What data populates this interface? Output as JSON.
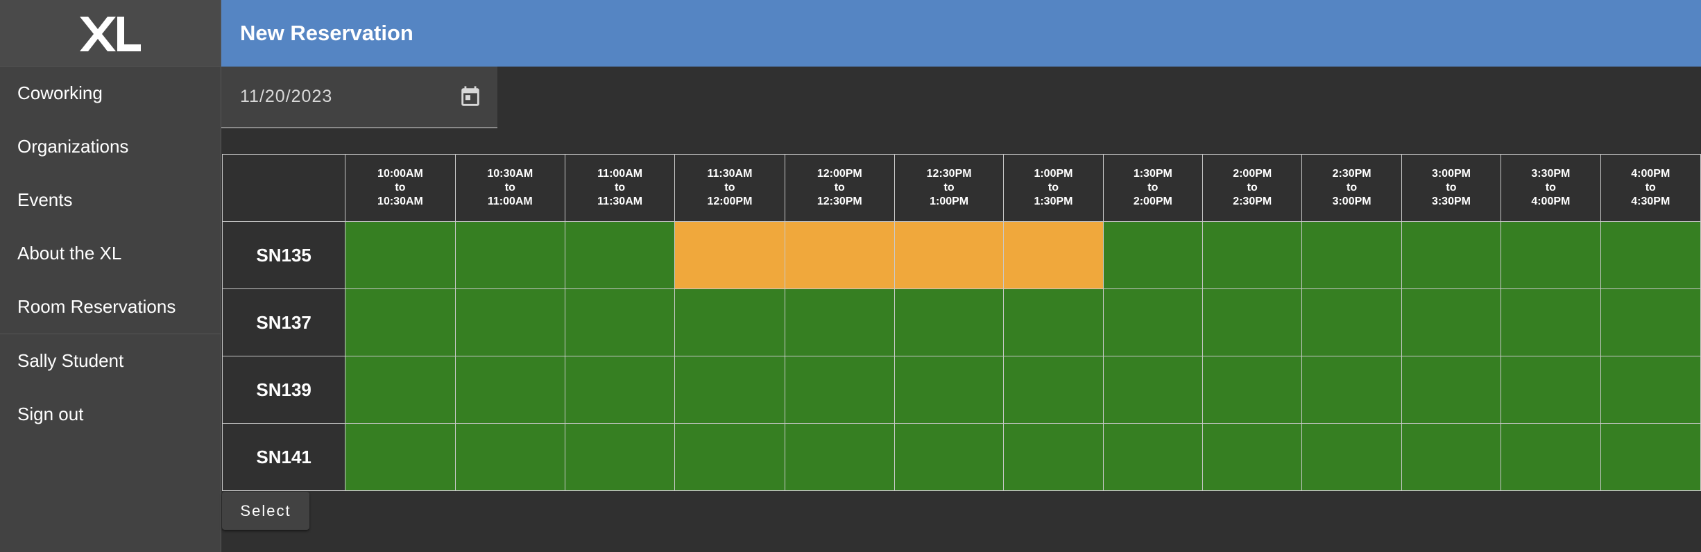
{
  "sidebar": {
    "logo_text": "XL",
    "nav_items": [
      {
        "label": "Coworking"
      },
      {
        "label": "Organizations"
      },
      {
        "label": "Events"
      },
      {
        "label": "About the XL"
      },
      {
        "label": "Room Reservations"
      }
    ],
    "user_items": [
      {
        "label": "Sally Student"
      },
      {
        "label": "Sign out"
      }
    ]
  },
  "header": {
    "title": "New Reservation"
  },
  "date_picker": {
    "value": "11/20/2023",
    "icon": "calendar-icon"
  },
  "grid": {
    "time_slots": [
      {
        "start": "10:00AM",
        "sep": "to",
        "end": "10:30AM"
      },
      {
        "start": "10:30AM",
        "sep": "to",
        "end": "11:00AM"
      },
      {
        "start": "11:00AM",
        "sep": "to",
        "end": "11:30AM"
      },
      {
        "start": "11:30AM",
        "sep": "to",
        "end": "12:00PM"
      },
      {
        "start": "12:00PM",
        "sep": "to",
        "end": "12:30PM"
      },
      {
        "start": "12:30PM",
        "sep": "to",
        "end": "1:00PM"
      },
      {
        "start": "1:00PM",
        "sep": "to",
        "end": "1:30PM"
      },
      {
        "start": "1:30PM",
        "sep": "to",
        "end": "2:00PM"
      },
      {
        "start": "2:00PM",
        "sep": "to",
        "end": "2:30PM"
      },
      {
        "start": "2:30PM",
        "sep": "to",
        "end": "3:00PM"
      },
      {
        "start": "3:00PM",
        "sep": "to",
        "end": "3:30PM"
      },
      {
        "start": "3:30PM",
        "sep": "to",
        "end": "4:00PM"
      },
      {
        "start": "4:00PM",
        "sep": "to",
        "end": "4:30PM"
      }
    ],
    "rooms": [
      {
        "name": "SN135",
        "slots": [
          "available",
          "available",
          "available",
          "reserved",
          "reserved",
          "reserved",
          "reserved",
          "available",
          "available",
          "available",
          "available",
          "available",
          "available"
        ]
      },
      {
        "name": "SN137",
        "slots": [
          "available",
          "available",
          "available",
          "available",
          "available",
          "available",
          "available",
          "available",
          "available",
          "available",
          "available",
          "available",
          "available"
        ]
      },
      {
        "name": "SN139",
        "slots": [
          "available",
          "available",
          "available",
          "available",
          "available",
          "available",
          "available",
          "available",
          "available",
          "available",
          "available",
          "available",
          "available"
        ]
      },
      {
        "name": "SN141",
        "slots": [
          "available",
          "available",
          "available",
          "available",
          "available",
          "available",
          "available",
          "available",
          "available",
          "available",
          "available",
          "available",
          "available"
        ]
      }
    ],
    "colors": {
      "available": "#367f22",
      "reserved": "#f0a83c"
    }
  },
  "actions": {
    "select_label": "Select"
  },
  "colors": {
    "header_bg": "#5585c3",
    "sidebar_bg": "#424242",
    "page_bg": "#303030"
  }
}
